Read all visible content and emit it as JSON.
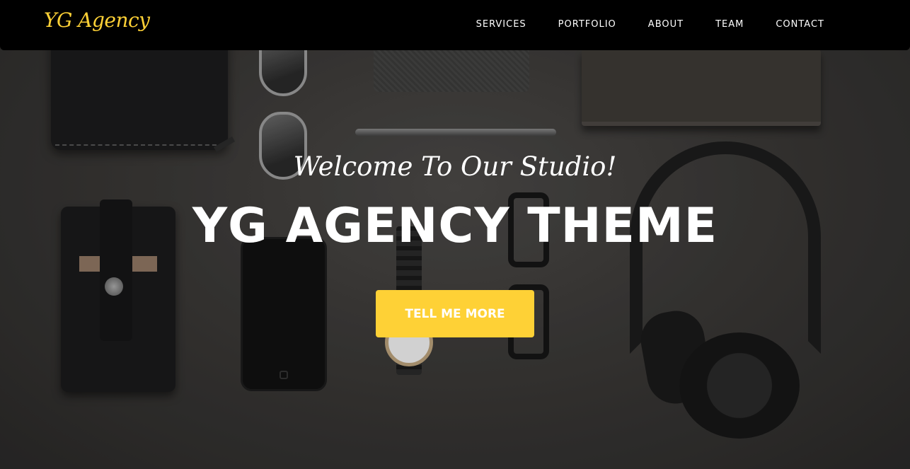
{
  "nav": {
    "brand": "YG Agency",
    "links": [
      {
        "label": "SERVICES"
      },
      {
        "label": "PORTFOLIO"
      },
      {
        "label": "ABOUT"
      },
      {
        "label": "TEAM"
      },
      {
        "label": "CONTACT"
      }
    ]
  },
  "hero": {
    "subheading": "Welcome To Our Studio!",
    "heading": "YG AGENCY THEME",
    "cta_label": "TELL ME MORE"
  },
  "colors": {
    "accent": "#fed136",
    "navbar": "#000000",
    "text": "#ffffff"
  }
}
